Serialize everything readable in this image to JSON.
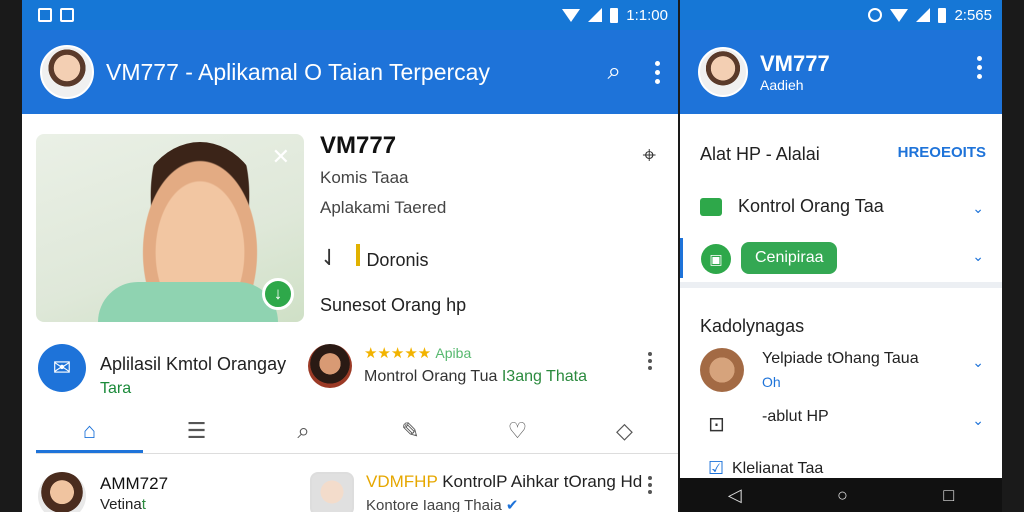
{
  "left": {
    "status": {
      "time": "1:1:00"
    },
    "appbar": {
      "title": "VM777 - Aplikamal O Taian Terpercay"
    },
    "card": {
      "title": "VM777",
      "sub1": "Komis Taaa",
      "sub2": "Aplakami Taered",
      "download_label": "Doronis",
      "sunset": "Sunesot Orang hp"
    },
    "row2": {
      "title": "Aplilasil Kmtol Orangay",
      "sub": "Tara",
      "stars": "★★★★★",
      "stars_text": "Apiba",
      "desc_main": "Montrol Orang Tua",
      "desc_green": "I3ang Thata"
    },
    "tabs": [
      "home-icon",
      "list-icon",
      "search-icon",
      "wrench-icon",
      "heart-icon",
      "shield-icon"
    ],
    "bottom": {
      "title1": "AMM727",
      "sub1_main": "Vetina",
      "sub1_green": "t",
      "title2_orange": "VDMFHP",
      "title2_rest": "KontrolP Aihkar tOrang Hd",
      "sub2": "Kontore Iaang Thaia"
    }
  },
  "right": {
    "status": {
      "time": "2:565"
    },
    "appbar": {
      "title": "VM777",
      "sub": "Aadieh"
    },
    "section1": {
      "head": "Alat HP - Alalai",
      "link": "HREOEOITS",
      "item1": "Kontrol Orang Taa",
      "item2_btn": "Cenipiraa"
    },
    "section2": {
      "head": "Kadolynagas",
      "item1_title": "Yelpiade tOhang Taua",
      "item1_sub": "Oh",
      "item2_title": "-ablut HP",
      "item3_title": "Klelianat Taa"
    }
  }
}
